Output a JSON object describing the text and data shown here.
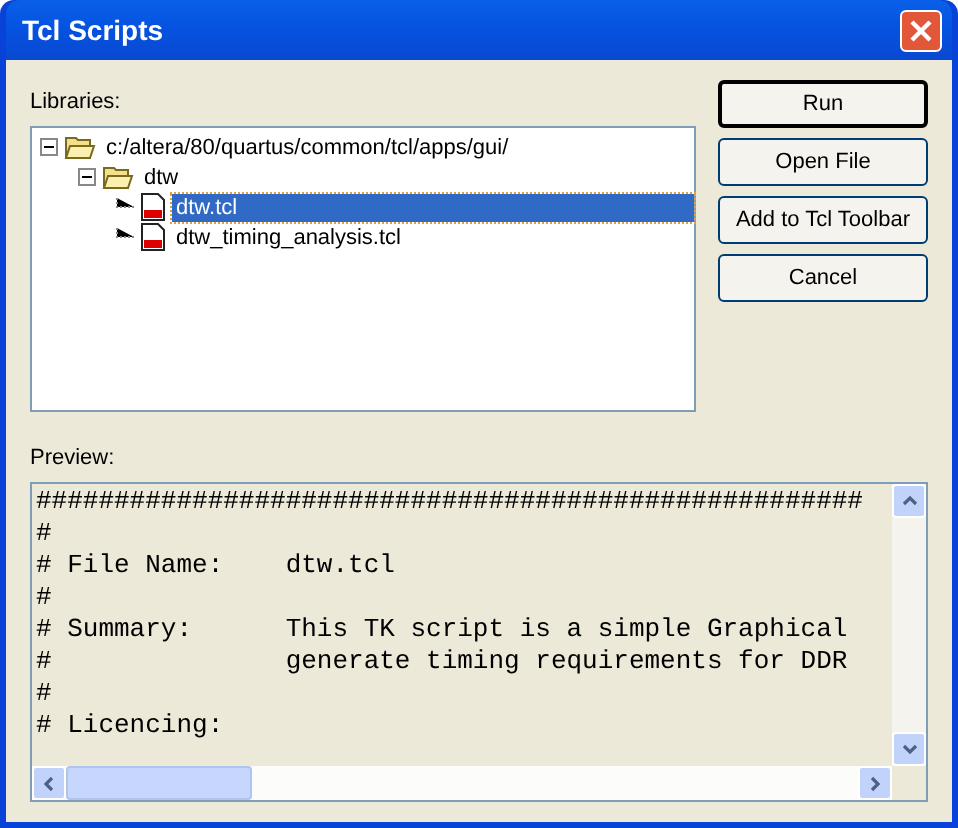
{
  "window": {
    "title": "Tcl Scripts"
  },
  "libraries": {
    "label": "Libraries:",
    "tree": [
      {
        "label": "c:/altera/80/quartus/common/tcl/apps/gui/",
        "kind": "folder",
        "expanded": true,
        "selected": false,
        "children": [
          {
            "label": "dtw",
            "kind": "folder",
            "expanded": true,
            "selected": false,
            "children": [
              {
                "label": "dtw.tcl",
                "kind": "file",
                "selected": true
              },
              {
                "label": "dtw_timing_analysis.tcl",
                "kind": "file",
                "selected": false
              }
            ]
          }
        ]
      }
    ]
  },
  "buttons": [
    {
      "label": "Run",
      "default": true
    },
    {
      "label": "Open File",
      "default": false
    },
    {
      "label": "Add to Tcl Toolbar",
      "default": false
    },
    {
      "label": "Cancel",
      "default": false
    }
  ],
  "preview": {
    "label": "Preview:",
    "lines": [
      "#####################################################",
      "#",
      "# File Name:    dtw.tcl",
      "#",
      "# Summary:      This TK script is a simple Graphical",
      "#               generate timing requirements for DDR",
      "#",
      "# Licencing:"
    ]
  }
}
